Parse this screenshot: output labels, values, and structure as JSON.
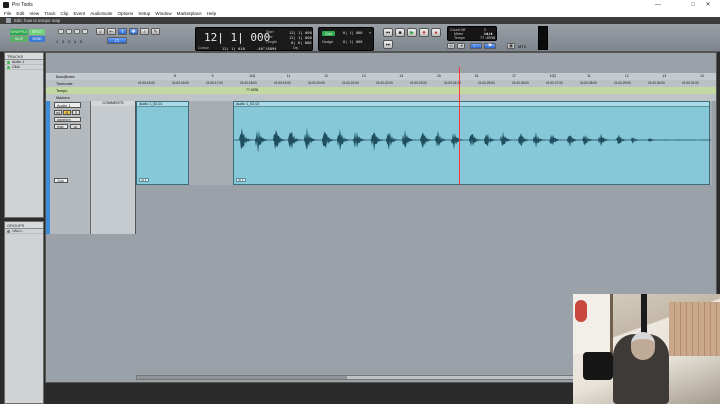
{
  "window": {
    "title": "Pro Tools",
    "subtitle": "Edit: how to tempo map",
    "minimize": "—",
    "maximize": "□",
    "close": "✕"
  },
  "menu": [
    "File",
    "Edit",
    "View",
    "Track",
    "Clip",
    "Event",
    "AudioSuite",
    "Options",
    "Setup",
    "Window",
    "Marketplace",
    "Help"
  ],
  "toolbar": {
    "mode_shuffle": "SHUFFLE",
    "mode_spot": "SPOT",
    "mode_slip": "SLIP",
    "mode_grid": "GRID",
    "zoom_presets": [
      "1",
      "2",
      "3",
      "4",
      "5"
    ]
  },
  "counter": {
    "main": "12| 1| 000",
    "start_label": "Start",
    "end_label": "End",
    "length_label": "Length",
    "start_value": "12| 1| 000",
    "end_value": "12| 1| 000",
    "length_value": "0| 0| 000",
    "cursor_label": "Cursor",
    "cursor_value": "12| 1| 018",
    "sample_value": "-40°/8894",
    "dly_label": "Dly"
  },
  "grid": {
    "badge": "Grid",
    "grid_value": "0| 1| 000",
    "nudge_label": "Nudge",
    "nudge_value": "0| 1| 000",
    "arrow": "▾"
  },
  "transport": [
    "⏮",
    "■",
    "▶",
    "⏺",
    "●",
    "⏭"
  ],
  "mini_counter": {
    "count_off_label": "Count Off",
    "meter_label": "Meter",
    "tempo_label": "Tempo",
    "count_off_value": "2 bars",
    "meter_value": "4/4",
    "tempo_value": "77.6938"
  },
  "mtc_label": "MTC",
  "tracks_panel": {
    "title": "TRACKS",
    "rows": [
      "Audio 1",
      "Click"
    ]
  },
  "groups_panel": {
    "title": "GROUPS",
    "rows": [
      "<ALL>"
    ]
  },
  "rulers": {
    "labels": [
      "Bars|Beats",
      "Timecode",
      "Tempo",
      "Markers"
    ],
    "bars": [
      "8",
      "9",
      "10|1",
      "11",
      "12",
      "13",
      "14",
      "15",
      "16",
      "17",
      "10|2",
      "11",
      "12",
      "13",
      "14"
    ],
    "timecode": [
      "01:00:15:00",
      "01:00:16:00",
      "01:00:17:00",
      "01:00:18:00",
      "01:00:19:00",
      "01:00:20:00",
      "01:00:21:00",
      "01:00:22:00",
      "01:00:23:00",
      "01:00:24:00",
      "01:00:25:00",
      "01:00:26:00",
      "01:00:27:00",
      "01:00:28:00",
      "01:00:29:00",
      "01:00:30:00",
      "01:00:31:00"
    ],
    "tempo_marker": "77.6938"
  },
  "track": {
    "name": "Audio 1",
    "input": "waveform",
    "rec_label": "rec",
    "mute": "M",
    "solo": "S",
    "read_label": "read",
    "comments_header": "COMMENTS",
    "second_track": "Click"
  },
  "clips": [
    {
      "name": "Audio 1_02-01",
      "foot": "⊞ 1"
    },
    {
      "name": "Audio 1_02-02",
      "foot": "⊞ 1"
    }
  ],
  "colors": {
    "clip_fill": "#86c7d8",
    "waveform": "#1f4f5e",
    "counter_bg": "#1a1a1a",
    "accent_green": "#2fa84f",
    "accent_blue": "#3b7bd6",
    "cursor": "#ff3a3a"
  },
  "icons": {
    "zoom": "magnifier-icon",
    "trim": "trim-icon",
    "selector": "selector-icon",
    "grabber": "grabber-icon",
    "pencil": "pencil-icon"
  }
}
